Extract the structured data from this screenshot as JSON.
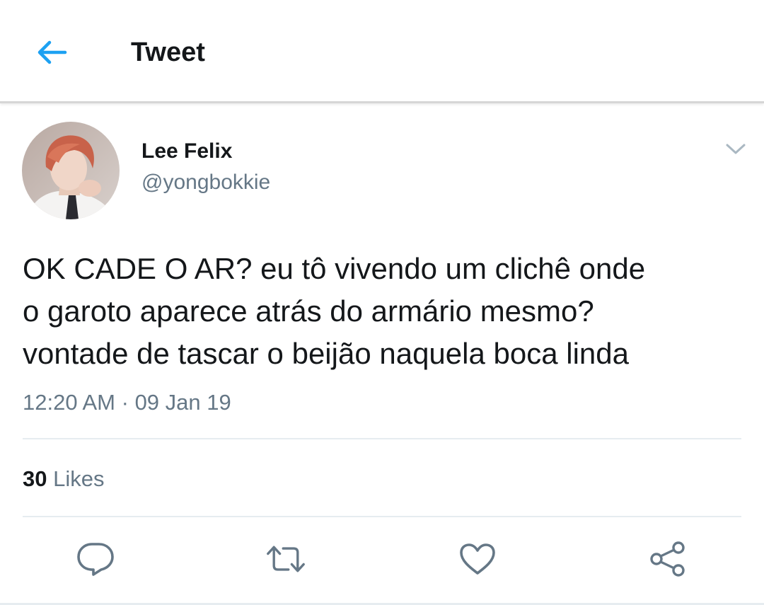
{
  "header": {
    "title": "Tweet",
    "back_icon": "back-arrow-icon"
  },
  "colors": {
    "accent": "#1da1f2",
    "text_primary": "#14171a",
    "text_secondary": "#657786",
    "divider": "#e6ecf0"
  },
  "tweet": {
    "author": {
      "name": "Lee Felix",
      "handle": "@yongbokkie"
    },
    "text_lines": [
      "OK CADE O AR? eu tô vivendo um clichê onde",
      "o garoto aparece atrás do armário mesmo?",
      "vontade de tascar o beijão naquela boca linda"
    ],
    "time": "12:20 AM",
    "separator": "·",
    "date": "09 Jan 19",
    "likes": {
      "count": "30",
      "label": "Likes"
    }
  },
  "actions": [
    {
      "name": "reply",
      "icon": "reply-icon"
    },
    {
      "name": "retweet",
      "icon": "retweet-icon"
    },
    {
      "name": "like",
      "icon": "heart-icon"
    },
    {
      "name": "share",
      "icon": "share-icon"
    }
  ]
}
